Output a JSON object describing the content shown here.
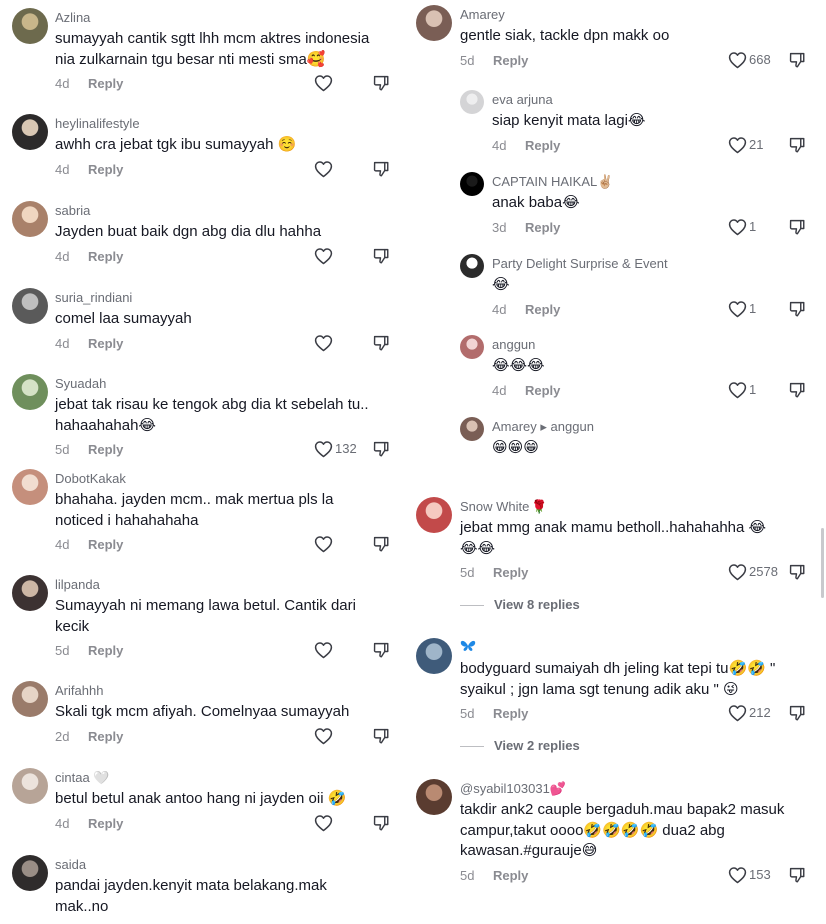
{
  "reply_label": "Reply",
  "colors": {
    "text": "#161823",
    "meta": "#8a8b91",
    "username": "#6a6d75",
    "rose": "#c0172e",
    "butterfly": "#1e88e5"
  },
  "left_comments": [
    {
      "username": "Azlina",
      "lines": [
        "sumayyah cantik sgtt lhh mcm aktres indonesia",
        "nia zulkarnain tgu besar nti mesti sma🥰"
      ],
      "time": "4d",
      "likes": ""
    },
    {
      "username": "heylinalifestyle",
      "lines": [
        "awhh cra jebat tgk ibu sumayyah ☺️"
      ],
      "time": "4d",
      "likes": ""
    },
    {
      "username": "sabria",
      "lines": [
        "Jayden buat baik dgn abg dia dlu hahha"
      ],
      "time": "4d",
      "likes": ""
    },
    {
      "username": "suria_rindiani",
      "lines": [
        "comel laa sumayyah"
      ],
      "time": "4d",
      "likes": ""
    },
    {
      "username": "Syuadah",
      "lines": [
        "jebat tak risau ke tengok abg dia kt sebelah tu..",
        "hahaahahah😂"
      ],
      "time": "5d",
      "likes": "132"
    },
    {
      "username": "DobotKakak",
      "lines": [
        "bhahaha. jayden mcm.. mak mertua pls la",
        "noticed i hahahahaha"
      ],
      "time": "4d",
      "likes": ""
    },
    {
      "username": "lilpanda",
      "lines": [
        "Sumayyah ni memang lawa betul. Cantik dari",
        "kecik"
      ],
      "time": "5d",
      "likes": ""
    },
    {
      "username": "Arifahhh",
      "lines": [
        "Skali tgk mcm afiyah. Comelnyaa sumayyah"
      ],
      "time": "2d",
      "likes": ""
    },
    {
      "username": "cintaa 🤍",
      "lines": [
        "betul betul anak antoo hang ni jayden oii 🤣"
      ],
      "time": "4d",
      "likes": ""
    },
    {
      "username": "saida",
      "lines": [
        "pandai jayden.kenyit mata belakang.mak",
        "mak..no"
      ],
      "time": "",
      "likes": ""
    }
  ],
  "right_comments": [
    {
      "username": "Amarey",
      "lines": [
        "gentle siak, tackle dpn makk oo"
      ],
      "time": "5d",
      "likes": "668"
    },
    {
      "username": "eva arjuna",
      "lines": [
        "siap kenyit mata lagi😂"
      ],
      "time": "4d",
      "likes": "21"
    },
    {
      "username": "CAPTAIN HAIKAL✌🏼",
      "lines": [
        "anak baba😂"
      ],
      "time": "3d",
      "likes": "1"
    },
    {
      "username": "Party Delight Surprise & Event",
      "lines": [
        "😂"
      ],
      "time": "4d",
      "likes": "1"
    },
    {
      "username": "anggun",
      "lines": [
        "😂😂😂"
      ],
      "time": "4d",
      "likes": "1"
    },
    {
      "username": "Amarey ▸ anggun",
      "lines": [
        "😁😁😁"
      ],
      "time": "",
      "likes": ""
    },
    {
      "username": "Snow White",
      "lines": [
        "jebat mmg anak mamu betholl..hahahahha 😂",
        "😂😂"
      ],
      "time": "5d",
      "likes": "2578"
    },
    {
      "username": "",
      "lines": [
        "bodyguard sumaiyah dh jeling kat tepi tu🤣🤣 \"",
        "syaikul ; jgn lama sgt tenung adik aku \" 😜"
      ],
      "time": "5d",
      "likes": "212"
    },
    {
      "username": "@syabil103031💕",
      "lines": [
        "takdir ank2 cauple bergaduh.mau bapak2 masuk",
        "campur,takut oooo🤣🤣🤣🤣 dua2 abg",
        "kawasan.#gurauje😅"
      ],
      "time": "5d",
      "likes": "153"
    }
  ],
  "view_replies": [
    "View 8 replies",
    "View 2 replies"
  ]
}
